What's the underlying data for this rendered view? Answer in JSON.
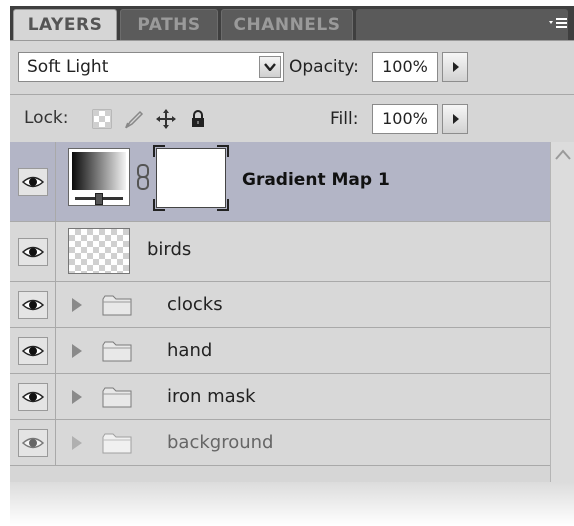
{
  "tabs": [
    {
      "label": "LAYERS",
      "active": true
    },
    {
      "label": "PATHS",
      "active": false
    },
    {
      "label": "CHANNELS",
      "active": false
    }
  ],
  "panel_menu_icon": "panel-menu-icon",
  "blend_mode": {
    "value": "Soft Light"
  },
  "opacity": {
    "label": "Opacity:",
    "value": "100%"
  },
  "lock": {
    "label": "Lock:",
    "icons": [
      "lock-transparent-pixels-icon",
      "lock-image-pixels-icon",
      "lock-position-icon",
      "lock-all-icon"
    ]
  },
  "fill": {
    "label": "Fill:",
    "value": "100%"
  },
  "layers": [
    {
      "name": "Gradient Map 1",
      "type": "adjustment",
      "selected": true,
      "visible": true
    },
    {
      "name": "birds",
      "type": "pixel",
      "selected": false,
      "visible": true
    },
    {
      "name": "clocks",
      "type": "group",
      "selected": false,
      "visible": true
    },
    {
      "name": "hand",
      "type": "group",
      "selected": false,
      "visible": true
    },
    {
      "name": "iron mask",
      "type": "group",
      "selected": false,
      "visible": true
    },
    {
      "name": "background",
      "type": "group",
      "selected": false,
      "visible": true,
      "dimmed": true
    }
  ],
  "colors": {
    "panel_bg": "#d6d6d6",
    "selected_row": "#b3b5c6",
    "tabbar": "#3f3f3f"
  }
}
